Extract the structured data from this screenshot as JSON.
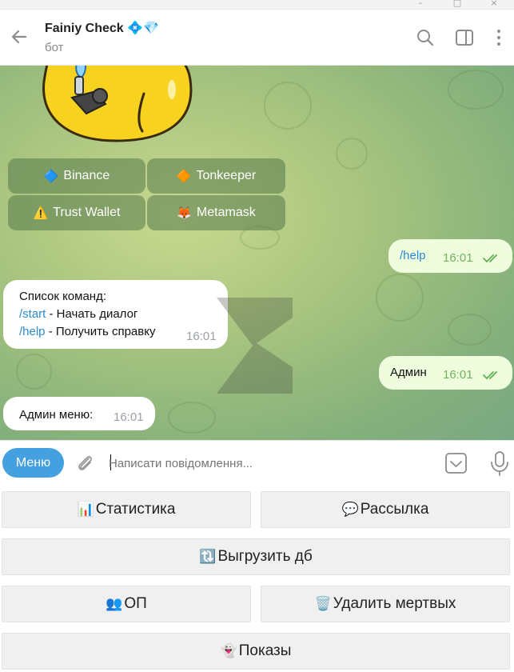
{
  "header": {
    "title": "Fainiy Check 💠💎",
    "subtitle": "бот"
  },
  "inline_keyboard": [
    {
      "emoji": "🔷",
      "label": "Binance"
    },
    {
      "emoji": "🔶",
      "label": "Tonkeeper"
    },
    {
      "emoji": "⚠️",
      "label": "Trust Wallet"
    },
    {
      "emoji": "🦊",
      "label": "Metamask"
    }
  ],
  "messages": [
    {
      "text": "/help",
      "time": "16:01"
    },
    {
      "line1": "Список команд:",
      "cmd1": "/start",
      "rest1": " - Начать диалог",
      "cmd2": "/help",
      "rest2": " - Получить справку",
      "time": "16:01"
    },
    {
      "text": "Админ",
      "time": "16:01"
    },
    {
      "text": "Админ меню:",
      "time": "16:01"
    }
  ],
  "composer": {
    "menu_label": "Меню",
    "placeholder": "Написати повідомлення..."
  },
  "reply_keyboard": [
    {
      "emoji": "📊",
      "label": "Статистика"
    },
    {
      "emoji": "💬",
      "label": "Рассылка"
    },
    {
      "emoji": "🔃",
      "label": "Выгрузить дб"
    },
    {
      "emoji": "👥",
      "label": "ОП"
    },
    {
      "emoji": "🗑️",
      "label": "Удалить мертвых"
    },
    {
      "emoji": "👻",
      "label": "Показы"
    }
  ],
  "colors": {
    "accent": "#45a0e0",
    "outgoing_bubble": "#effdde",
    "read_ticks": "#5fb052"
  }
}
